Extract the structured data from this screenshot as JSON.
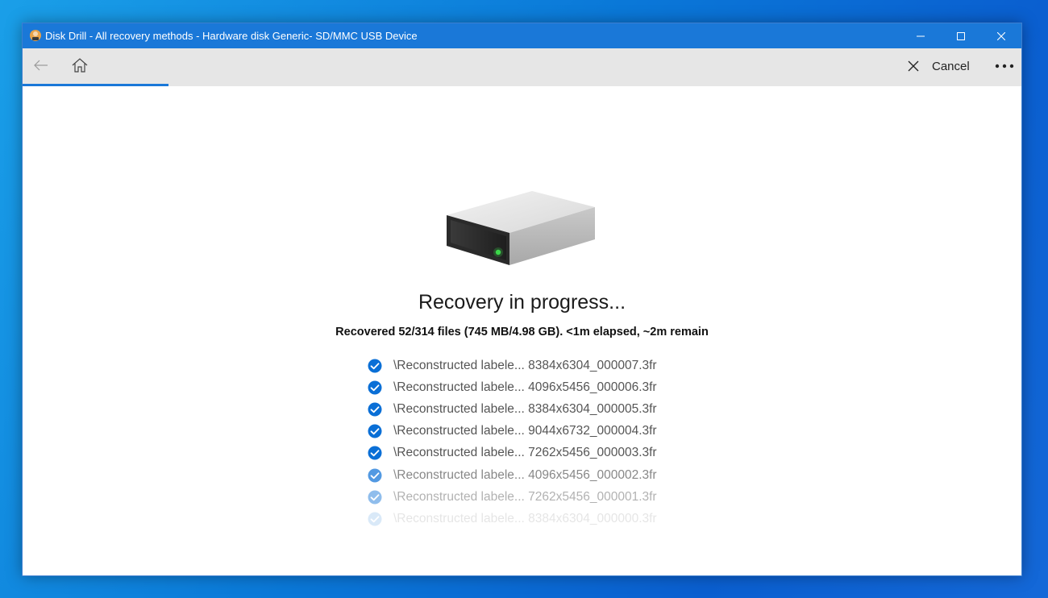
{
  "window": {
    "title": "Disk Drill - All recovery methods - Hardware disk Generic- SD/MMC USB Device"
  },
  "toolbar": {
    "back_icon": "back-arrow-icon",
    "home_icon": "home-icon",
    "cancel_label": "Cancel",
    "more_icon": "more-icon"
  },
  "main": {
    "heading": "Recovery in progress...",
    "status": "Recovered 52/314 files (745 MB/4.98 GB).  <1m elapsed, ~2m remain",
    "files": [
      {
        "name": "\\Reconstructed labele... 8384x6304_000007.3fr"
      },
      {
        "name": "\\Reconstructed labele... 4096x5456_000006.3fr"
      },
      {
        "name": "\\Reconstructed labele... 8384x6304_000005.3fr"
      },
      {
        "name": "\\Reconstructed labele... 9044x6732_000004.3fr"
      },
      {
        "name": "\\Reconstructed labele... 7262x5456_000003.3fr"
      },
      {
        "name": "\\Reconstructed labele... 4096x5456_000002.3fr"
      },
      {
        "name": "\\Reconstructed labele... 7262x5456_000001.3fr"
      },
      {
        "name": "\\Reconstructed labele... 8384x6304_000000.3fr"
      }
    ]
  },
  "colors": {
    "accent": "#1a78d8",
    "toolbar_bg": "#e6e6e6",
    "check": "#0a6fd6",
    "desktop": "#0a78d8"
  }
}
